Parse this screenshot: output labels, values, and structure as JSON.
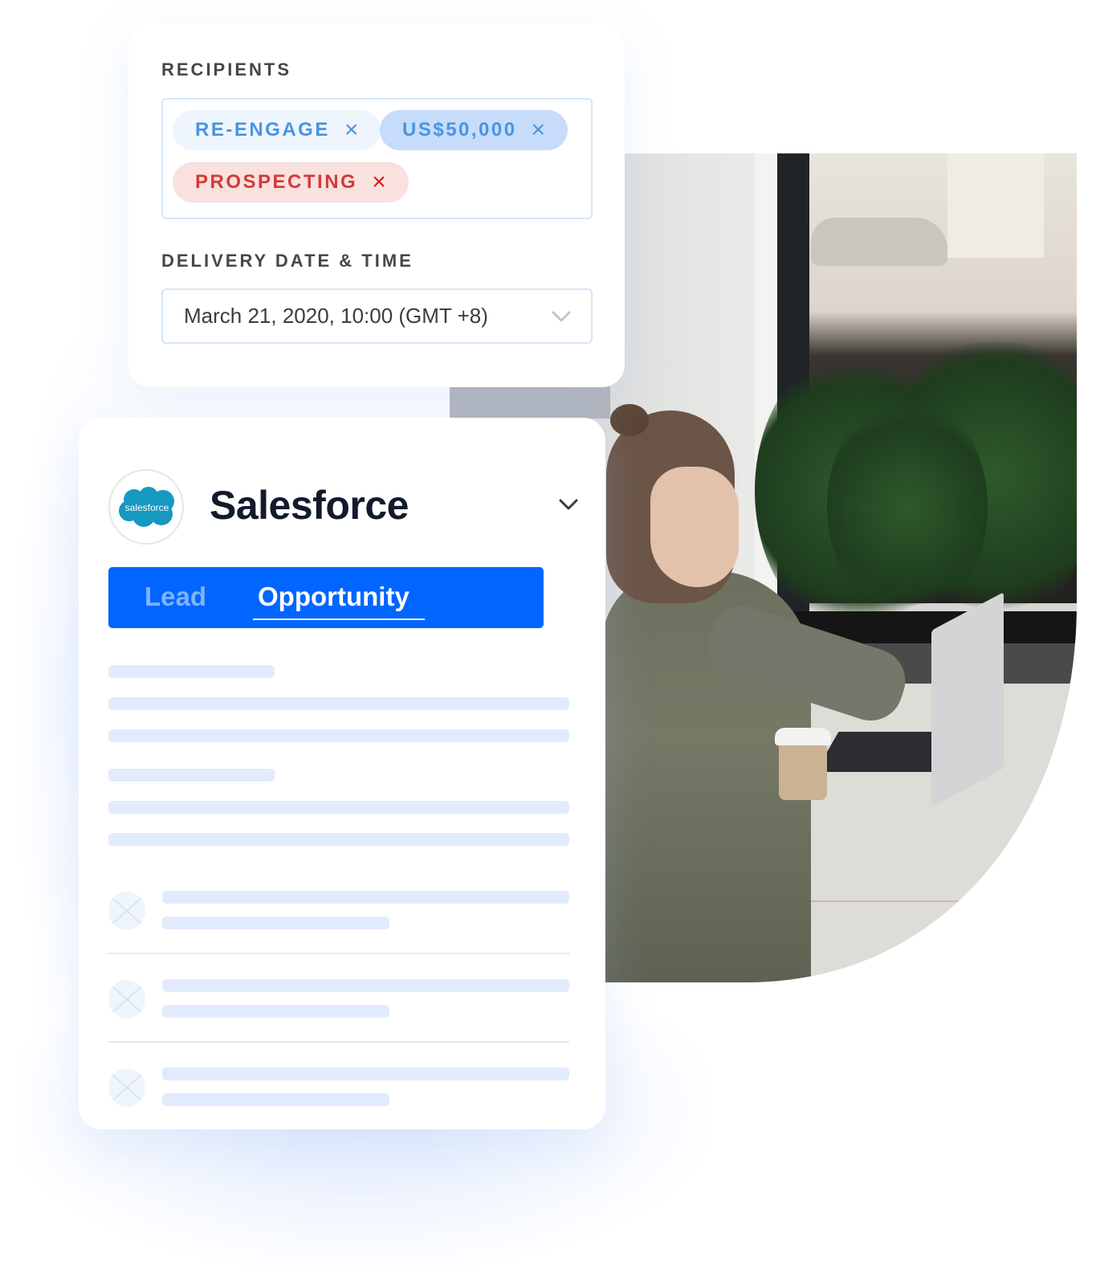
{
  "recipients": {
    "label": "RECIPIENTS",
    "tags": [
      {
        "text": "RE-ENGAGE",
        "remove_icon": "close-icon",
        "color": "#4a94e0",
        "bg": "#eef5fd"
      },
      {
        "text": "US$50,000",
        "remove_icon": "close-icon",
        "color": "#4a94e0",
        "bg": "#c6dcfa"
      },
      {
        "text": "PROSPECTING",
        "remove_icon": "close-icon",
        "color": "#d23a3a",
        "bg": "#f8e1de"
      }
    ],
    "remove_glyph": "×"
  },
  "delivery": {
    "label": "DELIVERY DATE & TIME",
    "value": "March 21, 2020, 10:00 (GMT +8)",
    "icon": "chevron-down-icon"
  },
  "integration": {
    "logo_text": "salesforce",
    "title": "Salesforce",
    "expand_icon": "chevron-down-icon",
    "tabs": [
      {
        "label": "Lead",
        "active": false
      },
      {
        "label": "Opportunity",
        "active": true
      }
    ],
    "accent_color": "#0066ff",
    "placeholder_rows": 3
  },
  "photo": {
    "description": "woman-typing-on-laptop-with-coffee-cup"
  }
}
